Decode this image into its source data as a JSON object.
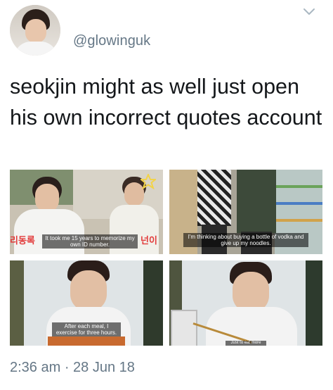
{
  "tweet": {
    "handle": "@glowinguk",
    "text": "seokjin might as well just open his own incorrect quotes account",
    "timestamp": "2:36 am · 28 Jun 18"
  },
  "images": [
    {
      "caption": "It took me 15 years to memorize my own ID number."
    },
    {
      "caption": "I'm thinking about buying a bottle of vodka and give up my noodles."
    },
    {
      "caption": "After each meal, I exercise for three hours."
    },
    {
      "caption": "Just to eat more"
    }
  ],
  "icons": {
    "menu": "chevron-down-icon"
  }
}
